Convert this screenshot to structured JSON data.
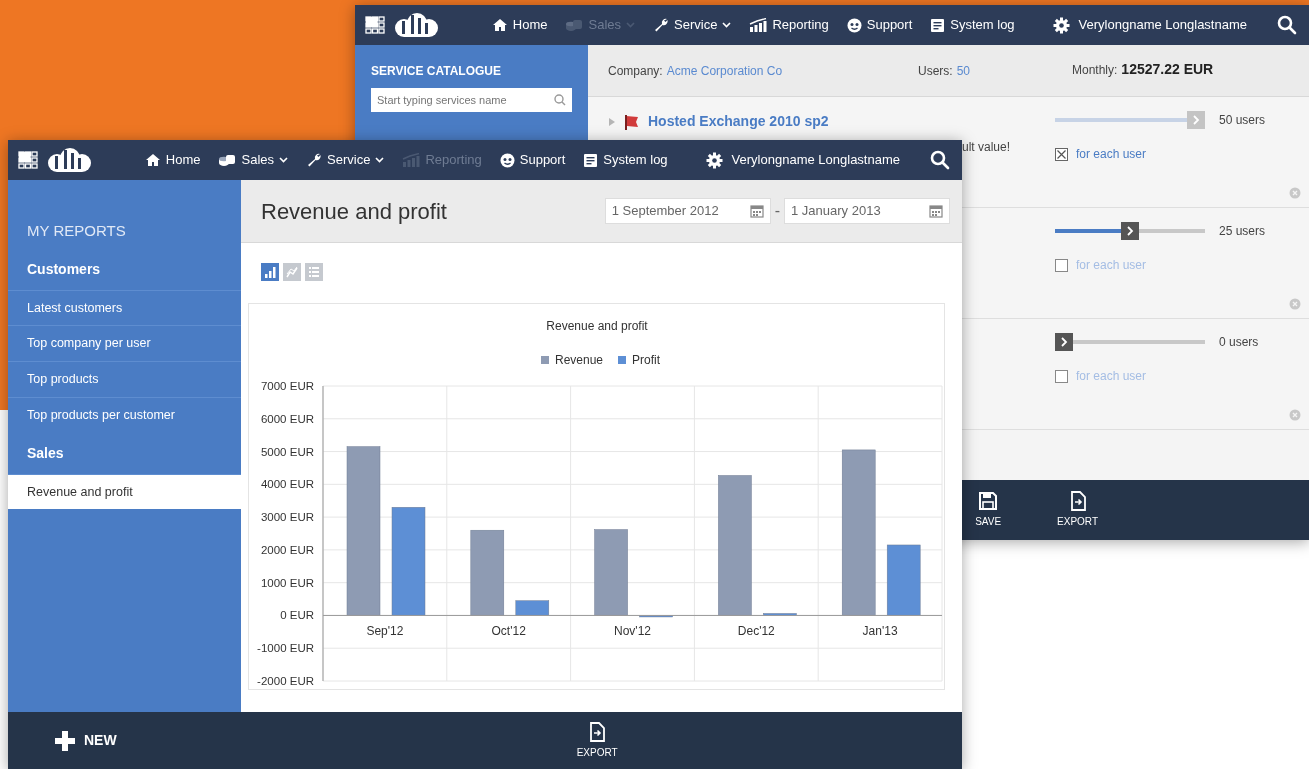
{
  "back_window": {
    "navbar": {
      "items": [
        {
          "kind": "home",
          "label": "Home",
          "disabled": false,
          "has_menu": false
        },
        {
          "kind": "sales",
          "label": "Sales",
          "disabled": true,
          "has_menu": true
        },
        {
          "kind": "service",
          "label": "Service",
          "disabled": false,
          "has_menu": true
        },
        {
          "kind": "reporting",
          "label": "Reporting",
          "disabled": false,
          "has_menu": false
        },
        {
          "kind": "support",
          "label": "Support",
          "disabled": false,
          "has_menu": false
        },
        {
          "kind": "log",
          "label": "System log",
          "disabled": false,
          "has_menu": false
        }
      ],
      "user": "Verylongname Longlastname"
    },
    "sidebar": {
      "title": "SERVICE CATALOGUE",
      "search": {
        "placeholder": "Start typing services name"
      }
    },
    "summary": {
      "company_label": "Company:",
      "company": "Acme Corporation Co",
      "users_label": "Users:",
      "users": "50",
      "monthly_label": "Monthly:",
      "monthly": "12527.22 EUR"
    },
    "services": [
      {
        "name": "Hosted Exchange 2010 sp2",
        "note": "ult value!",
        "expanded": false,
        "slider": {
          "level": 1,
          "disabled": true
        },
        "reading": "50 users",
        "for_each_user": {
          "label": "for each user",
          "checked": true
        }
      },
      {
        "slider": {
          "level": 0.5,
          "disabled": false
        },
        "reading": "25 users",
        "for_each_user": {
          "label": "for each user",
          "checked": false
        }
      },
      {
        "slider": {
          "level": 0,
          "disabled": false
        },
        "reading": "0 users",
        "for_each_user": {
          "label": "for each user",
          "checked": false
        }
      }
    ],
    "toolbar": [
      {
        "kind": "save",
        "label": "SAVE"
      },
      {
        "kind": "export",
        "label": "EXPORT"
      }
    ]
  },
  "front_window": {
    "navbar": {
      "items": [
        {
          "kind": "home",
          "label": "Home",
          "disabled": false,
          "has_menu": false
        },
        {
          "kind": "sales",
          "label": "Sales",
          "disabled": false,
          "has_menu": true
        },
        {
          "kind": "service",
          "label": "Service",
          "disabled": false,
          "has_menu": true
        },
        {
          "kind": "reporting",
          "label": "Reporting",
          "disabled": true,
          "has_menu": false
        },
        {
          "kind": "support",
          "label": "Support",
          "disabled": false,
          "has_menu": false
        },
        {
          "kind": "log",
          "label": "System log",
          "disabled": false,
          "has_menu": false
        }
      ],
      "user": "Verylongname Longlastname"
    },
    "sidebar": {
      "title": "MY REPORTS",
      "groups": [
        {
          "label": "Customers",
          "items": [
            {
              "label": "Latest customers",
              "selected": false
            },
            {
              "label": "Top company per user",
              "selected": false
            },
            {
              "label": "Top products",
              "selected": false
            },
            {
              "label": "Top products per customer",
              "selected": false
            }
          ]
        },
        {
          "label": "Sales",
          "items": [
            {
              "label": "Revenue and profit",
              "selected": true
            }
          ]
        }
      ]
    },
    "page_title": "Revenue and profit",
    "date_from": "1 September 2012",
    "date_separator": "-",
    "date_to": "1 January 2013",
    "chart_views": [
      {
        "kind": "bar",
        "selected": true
      },
      {
        "kind": "line",
        "selected": false
      },
      {
        "kind": "list",
        "selected": false
      }
    ],
    "chart": {
      "chart_data": {
        "type": "bar",
        "title": "Revenue and profit",
        "categories": [
          "Sep'12",
          "Oct'12",
          "Nov'12",
          "Dec'12",
          "Jan'13"
        ],
        "series": [
          {
            "name": "Revenue",
            "color": "#8e9bb3",
            "values": [
              5150,
              2600,
              2620,
              4270,
              5050
            ]
          },
          {
            "name": "Profit",
            "color": "#5d8fd5",
            "values": [
              3300,
              450,
              -30,
              60,
              2150
            ]
          }
        ],
        "ylim": [
          -2000,
          7000
        ],
        "grid": true,
        "legend": true,
        "yticks": [
          {
            "value": -2000,
            "label": "-2000 EUR"
          },
          {
            "value": -1000,
            "label": "-1000 EUR"
          },
          {
            "value": 0,
            "label": "0 EUR"
          },
          {
            "value": 1000,
            "label": "1000 EUR"
          },
          {
            "value": 2000,
            "label": "2000 EUR"
          },
          {
            "value": 3000,
            "label": "3000 EUR"
          },
          {
            "value": 4000,
            "label": "4000 EUR"
          },
          {
            "value": 5000,
            "label": "5000 EUR"
          },
          {
            "value": 6000,
            "label": "6000 EUR"
          },
          {
            "value": 7000,
            "label": "7000 EUR"
          }
        ]
      }
    },
    "toolbar": [
      {
        "kind": "new",
        "label": "NEW"
      },
      {
        "kind": "export",
        "label": "EXPORT"
      }
    ]
  }
}
